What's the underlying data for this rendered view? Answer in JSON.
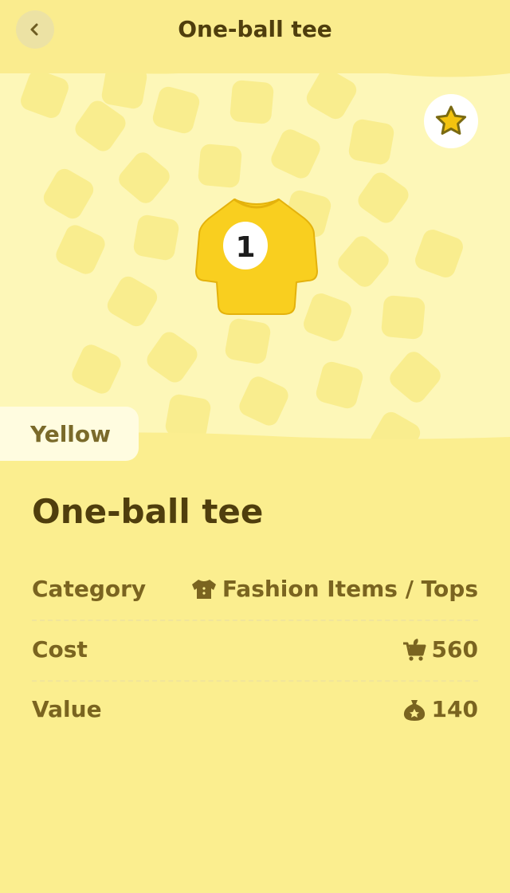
{
  "header": {
    "title": "One-ball tee"
  },
  "hero": {
    "shirt_number": "1"
  },
  "color_tab": {
    "label": "Yellow"
  },
  "item": {
    "name": "One-ball tee",
    "rows": [
      {
        "label": "Category",
        "value": "Fashion Items / Tops",
        "icon": "shirt-icon"
      },
      {
        "label": "Cost",
        "value": "560",
        "icon": "shopping-cart-icon"
      },
      {
        "label": "Value",
        "value": "140",
        "icon": "bell-bag-icon"
      }
    ]
  },
  "colors": {
    "accent": "#fbee8f",
    "hero": "#fdf7b8",
    "text": "#4f3e0d",
    "star": "#f3c30f"
  }
}
